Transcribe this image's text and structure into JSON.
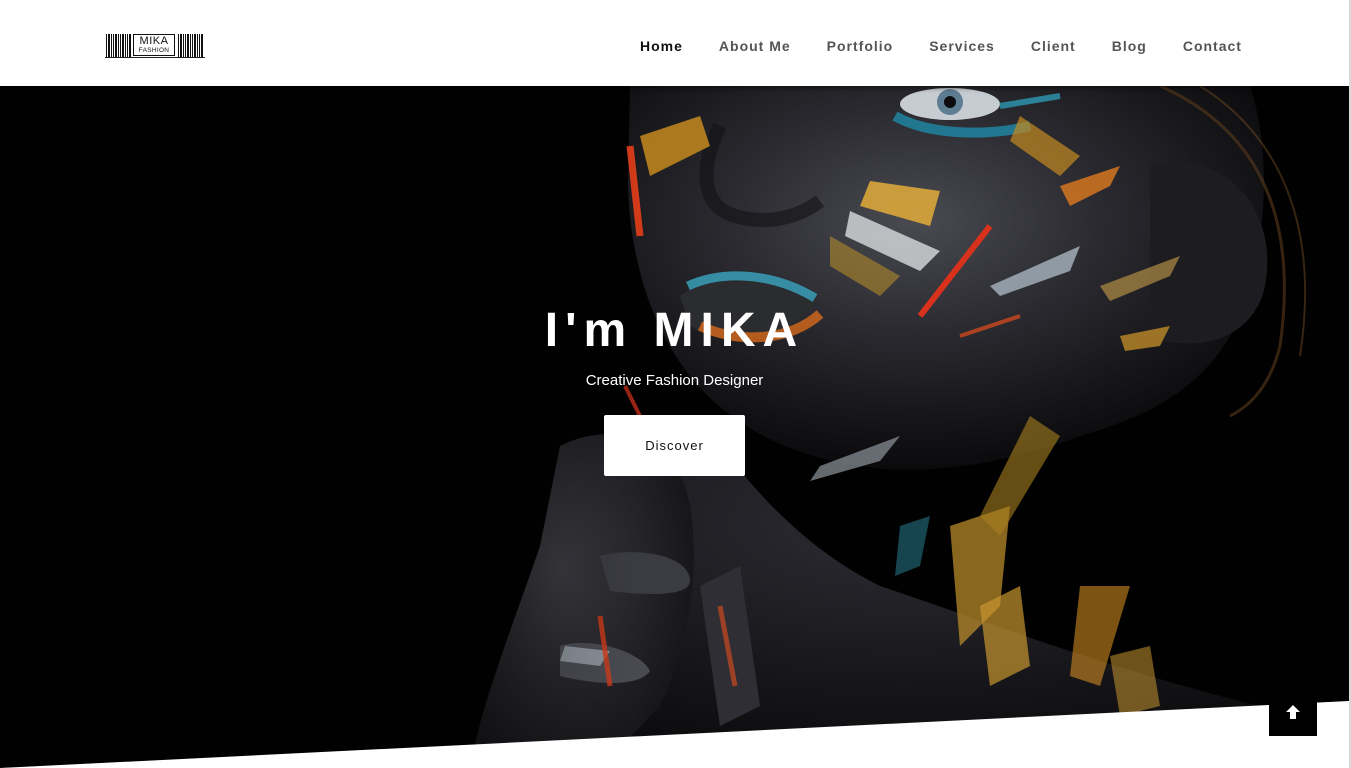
{
  "brand": {
    "logo_word": "MIKA",
    "logo_sub": "FASHION"
  },
  "nav": {
    "items": [
      {
        "label": "Home",
        "active": true
      },
      {
        "label": "About Me",
        "active": false
      },
      {
        "label": "Portfolio",
        "active": false
      },
      {
        "label": "Services",
        "active": false
      },
      {
        "label": "Client",
        "active": false
      },
      {
        "label": "Blog",
        "active": false
      },
      {
        "label": "Contact",
        "active": false
      }
    ]
  },
  "hero": {
    "title": "I'm MIKA",
    "subtitle": "Creative Fashion Designer",
    "cta_label": "Discover",
    "image_name": "painted-face-portrait"
  },
  "scroll_top": {
    "icon": "arrow-up-icon"
  },
  "colors": {
    "header_bg": "#ffffff",
    "hero_bg": "#010101",
    "accent_text": "#ffffff",
    "scroll_button_bg": "#000000"
  }
}
